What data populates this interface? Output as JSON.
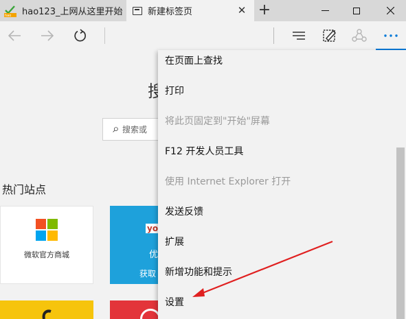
{
  "tabs": [
    {
      "title": "hao123_上网从这里开始",
      "icon": "hao123-favicon",
      "active": false
    },
    {
      "title": "新建标签页",
      "icon": "page-icon",
      "active": true
    }
  ],
  "window": {
    "new_tab": "+",
    "close": "✕"
  },
  "page": {
    "search_heading": "搜",
    "search_placeholder": "搜索或",
    "hot_sites_title": "热门站点",
    "tiles": [
      {
        "label": "微软官方商城"
      },
      {
        "badge": "you",
        "line1": "优",
        "line2": "获取"
      }
    ]
  },
  "menu": {
    "items": [
      {
        "label": "在页面上查找",
        "enabled": true
      },
      {
        "label": "打印",
        "enabled": true
      },
      {
        "label": "将此页固定到\"开始\"屏幕",
        "enabled": false
      },
      {
        "label": "F12 开发人员工具",
        "enabled": true
      },
      {
        "label": "使用 Internet Explorer 打开",
        "enabled": false
      },
      {
        "label": "发送反馈",
        "enabled": true
      },
      {
        "label": "扩展",
        "enabled": true
      },
      {
        "label": "新增功能和提示",
        "enabled": true
      },
      {
        "label": "设置",
        "enabled": true
      }
    ]
  },
  "colors": {
    "accent": "#0078d7",
    "annotation_arrow": "#e02020",
    "ms_red": "#f25022",
    "ms_green": "#7fba00",
    "ms_blue": "#00a4ef",
    "ms_yellow": "#ffb900"
  }
}
